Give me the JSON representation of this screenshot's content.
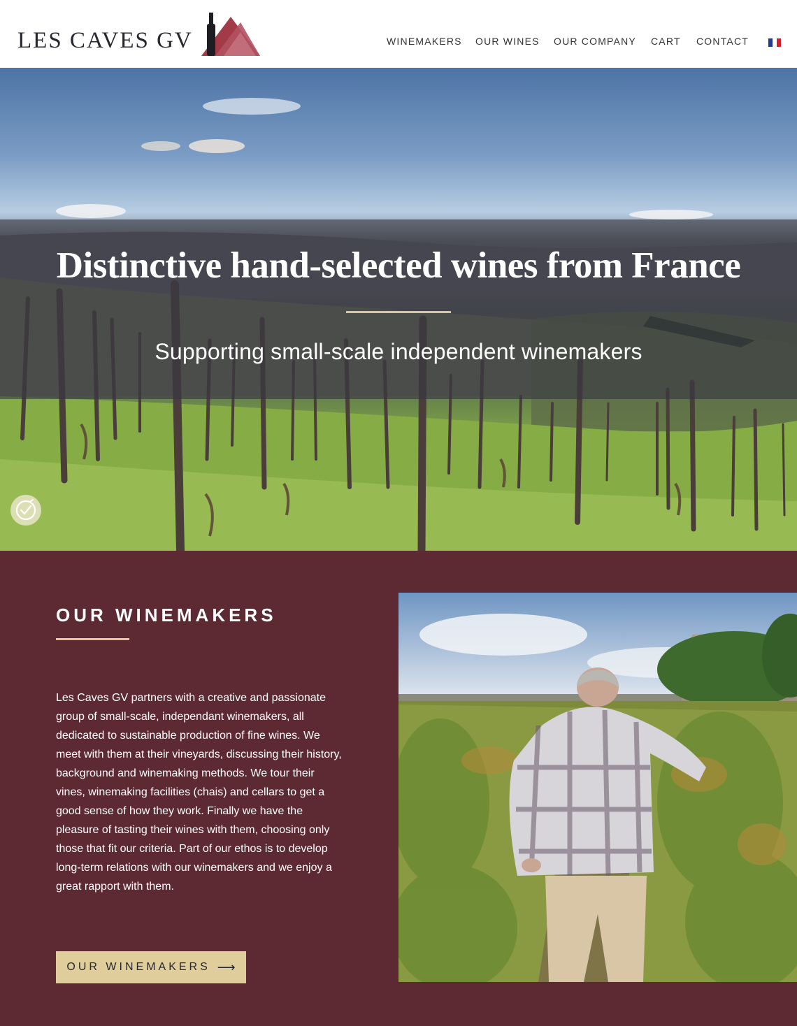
{
  "header": {
    "brand": "LES CAVES GV",
    "nav": [
      {
        "label": "WINEMAKERS"
      },
      {
        "label": "OUR WINES"
      },
      {
        "label": "OUR COMPANY"
      },
      {
        "label": "CART"
      },
      {
        "label": "CONTACT"
      }
    ],
    "language_flag": "french-flag-icon"
  },
  "hero": {
    "title": "Distinctive hand-selected wines from France",
    "subtitle": "Supporting small-scale independent winemakers",
    "accessibility_icon": "accessibility-icon"
  },
  "winemakers": {
    "heading": "OUR WINEMAKERS",
    "body": "Les Caves GV partners with a creative and passionate group of small-scale, independant winemakers, all dedicated to sustainable production of fine wines. We meet with them at their vineyards, discussing their history, background and winemaking methods. We tour their vines, winemaking facilities (chais) and cellars to get a good sense of how they work. Finally we have the pleasure of tasting their wines with them, choosing only those that fit our criteria. Part of our ethos is to develop long-term relations with our winemakers and we enjoy a great rapport with them.",
    "button_label": "OUR WINEMAKERS",
    "button_arrow": "⟶"
  },
  "colors": {
    "brand_text": "#262730",
    "section_bg": "#5d2a33",
    "accent_gold": "#dcc79a",
    "button_bg": "#e0cd9c",
    "logo_red": "#a33a48"
  }
}
